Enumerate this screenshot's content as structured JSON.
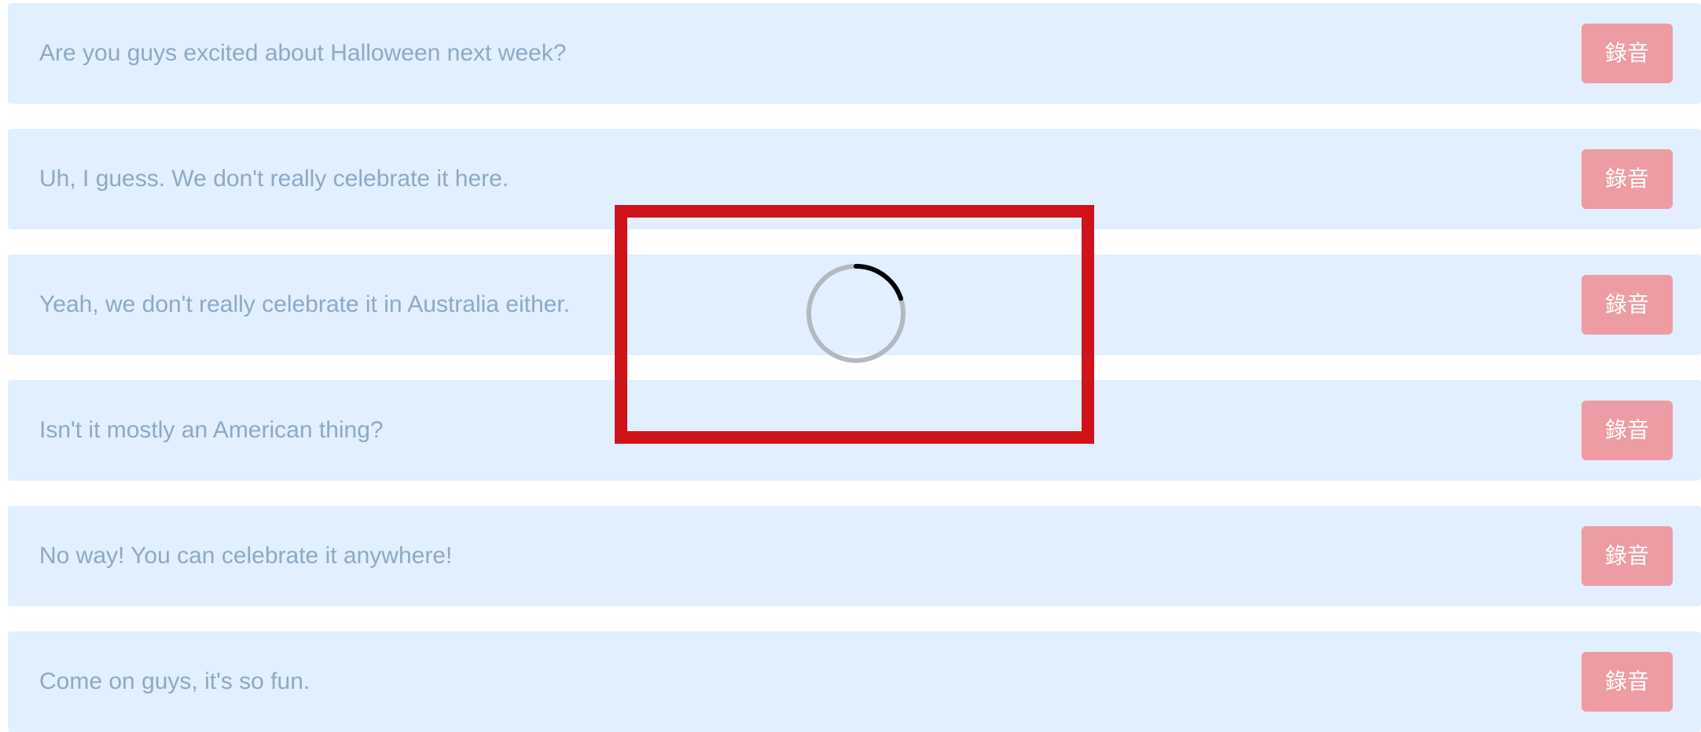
{
  "dialogue": {
    "rows": [
      {
        "text": "Are you guys excited about Halloween next week?",
        "button_label": "錄音"
      },
      {
        "text": "Uh, I guess. We don't really celebrate it here.",
        "button_label": "錄音"
      },
      {
        "text": "Yeah, we don't really celebrate it in Australia either.",
        "button_label": "錄音"
      },
      {
        "text": "Isn't it mostly an American thing?",
        "button_label": "錄音"
      },
      {
        "text": "No way! You can celebrate it anywhere!",
        "button_label": "錄音"
      },
      {
        "text": "Come on guys, it's so fun.",
        "button_label": "錄音"
      }
    ]
  },
  "loading": {
    "icon": "loading-spinner-icon",
    "highlight_color": "#d0121b"
  },
  "colors": {
    "row_background": "#e1efff",
    "row_text": "#8ea9c3",
    "button_background": "#ee9ca3",
    "button_text": "#ffffff"
  }
}
